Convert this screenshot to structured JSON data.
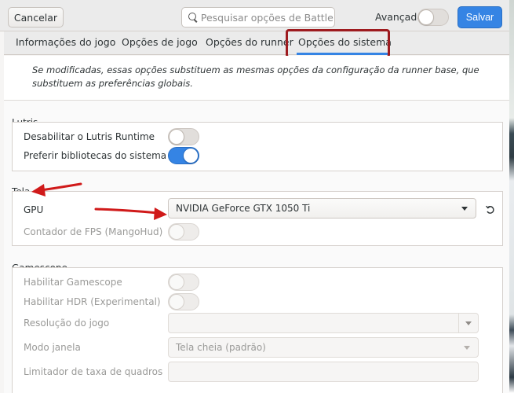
{
  "header": {
    "cancel_label": "Cancelar",
    "search_placeholder": "Pesquisar opções de Battlene...",
    "advanced_label": "Avançado",
    "advanced_on": false,
    "save_label": "Salvar"
  },
  "tabs": [
    {
      "label": "Informações do jogo",
      "active": false
    },
    {
      "label": "Opções de jogo",
      "active": false
    },
    {
      "label": "Opções do runner",
      "active": false
    },
    {
      "label": "Opções do sistema",
      "active": true
    }
  ],
  "info_text": "Se modificadas, essas opções substituem as mesmas opções da configuração da runner base, que substituem as preferências globais.",
  "sections": {
    "lutris": {
      "title": "Lutris",
      "rows": [
        {
          "label": "Desabilitar o Lutris Runtime",
          "enabled": false
        },
        {
          "label": "Preferir bibliotecas do sistema",
          "enabled": true
        }
      ]
    },
    "tela": {
      "title": "Tela",
      "gpu_label": "GPU",
      "gpu_value": "NVIDIA GeForce GTX 1050 Ti",
      "fps_label": "Contador de FPS (MangoHud)",
      "fps_enabled": false
    },
    "gamescope": {
      "title": "Gamescope",
      "enable_label": "Habilitar Gamescope",
      "enable_value": false,
      "hdr_label": "Habilitar HDR (Experimental)",
      "hdr_value": false,
      "resolution_label": "Resolução do jogo",
      "resolution_value": "",
      "window_mode_label": "Modo janela",
      "window_mode_value": "Tela cheia (padrão)",
      "fps_limit_label": "Limitador de taxa de quadros",
      "fps_limit_value": ""
    }
  },
  "colors": {
    "accent": "#3584e4",
    "annotation_red": "#d01a1a",
    "highlight_box": "#9e1b1f"
  }
}
